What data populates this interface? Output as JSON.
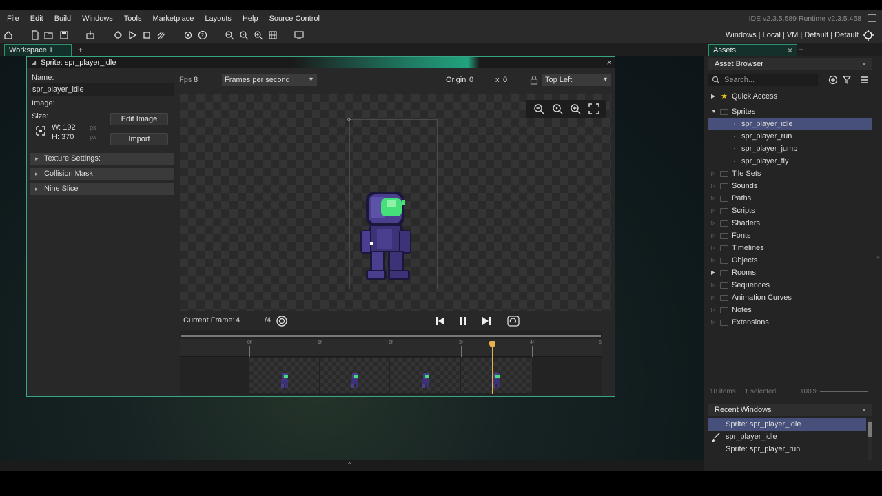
{
  "menu": {
    "items": [
      "File",
      "Edit",
      "Build",
      "Windows",
      "Tools",
      "Marketplace",
      "Layouts",
      "Help",
      "Source Control"
    ],
    "ide_version": "IDE v2.3.5.589  Runtime v2.3.5.458"
  },
  "toolbar": {
    "target_text": "Windows | Local | VM | Default | Default"
  },
  "workspace": {
    "tab_label": "Workspace 1",
    "add_label": "+"
  },
  "sprite_editor": {
    "title": "Sprite: spr_player_idle",
    "close": "×",
    "name_label": "Name:",
    "name_value": "spr_player_idle",
    "image_label": "Image:",
    "size_label": "Size:",
    "width": "W: 192",
    "height": "H: 370",
    "px": "px",
    "edit_image": "Edit Image",
    "import": "Import",
    "sections": [
      "Texture Settings:",
      "Collision Mask",
      "Nine Slice"
    ],
    "fps_label": "Fps",
    "fps_value": "8",
    "fps_mode": "Frames per second",
    "origin_label": "Origin",
    "origin_x": "0",
    "origin_sep": "x",
    "origin_y": "0",
    "origin_preset": "Top Left",
    "current_frame_label": "Current Frame:",
    "current_frame_value": "4",
    "frame_total": "/4",
    "timeline_ticks": [
      "0f",
      "1f",
      "2f",
      "3f",
      "4f",
      "5"
    ],
    "playhead_frame": 3.5
  },
  "assets": {
    "tab_label": "Assets",
    "tab_close": "×",
    "add": "+",
    "browser_label": "Asset Browser",
    "search_placeholder": "Search...",
    "quick_access": "Quick Access",
    "sprites_label": "Sprites",
    "sprites": [
      "spr_player_idle",
      "spr_player_run",
      "spr_player_jump",
      "spr_player_fly"
    ],
    "folders": [
      "Tile Sets",
      "Sounds",
      "Paths",
      "Scripts",
      "Shaders",
      "Fonts",
      "Timelines",
      "Objects",
      "Rooms",
      "Sequences",
      "Animation Curves",
      "Notes",
      "Extensions"
    ],
    "status_items": "18 items",
    "status_selected": "1 selected",
    "status_zoom": "100%"
  },
  "recent": {
    "label": "Recent Windows",
    "items": [
      "Sprite: spr_player_idle",
      "spr_player_idle",
      "Sprite: spr_player_run"
    ]
  },
  "colors": {
    "accent": "#2f8f6f",
    "selection": "#47507a",
    "playhead": "#e8b04a",
    "helmet": "#4a3f8f",
    "visor": "#46e07a"
  }
}
